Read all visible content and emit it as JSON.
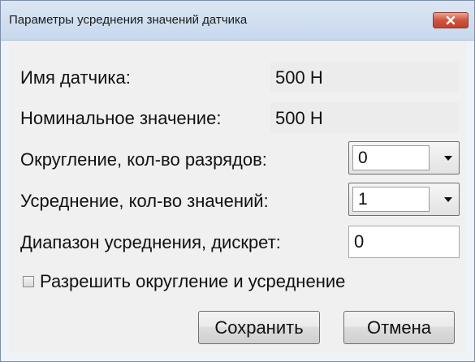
{
  "window": {
    "title": "Параметры усреднения значений датчика",
    "close_icon": "close-x-icon"
  },
  "form": {
    "sensor_name_label": "Имя датчика:",
    "sensor_name_value": "500 Н",
    "nominal_label": "Номинальное значение:",
    "nominal_value": "500 Н",
    "rounding_label": "Округление, кол-во разрядов:",
    "rounding_value": "0",
    "averaging_label": "Усреднение, кол-во значений:",
    "averaging_value": "1",
    "range_label": "Диапазон усреднения, дискрет:",
    "range_value": "0",
    "enable_label": "Разрешить округление и усреднение",
    "enable_checked": false
  },
  "buttons": {
    "save": "Сохранить",
    "cancel": "Отмена"
  },
  "colors": {
    "close_button": "#d0543d",
    "titlebar": "#c8d8ec"
  }
}
